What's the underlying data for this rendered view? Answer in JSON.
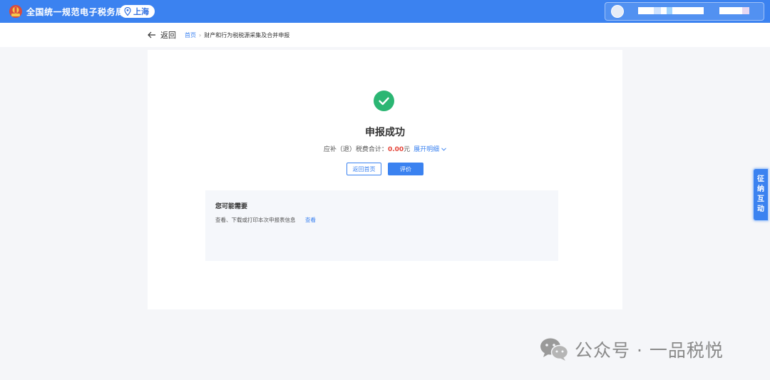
{
  "topbar": {
    "brand": "全国统一规范电子税务局",
    "region": "上海"
  },
  "nav": {
    "back_label": "返回",
    "breadcrumb": {
      "home": "首页",
      "separator": "›",
      "current": "财产和行为税税源采集及合并申报"
    }
  },
  "result": {
    "title": "申报成功",
    "summary_label": "应补（退）税费合计：",
    "amount": "0.00",
    "amount_unit": "元",
    "detail_link": "展开明细",
    "btn_home": "返回首页",
    "btn_rate": "评价"
  },
  "suggest": {
    "title": "您可能需要",
    "text": "查看、下载或打印本次申报表信息",
    "link": "查看"
  },
  "side_tab": [
    "征",
    "纳",
    "互",
    "动"
  ],
  "watermark": "公众号 · 一品税悦",
  "colors": {
    "primary": "#3b82f0",
    "success": "#2bb673",
    "amount": "#e5463a"
  }
}
